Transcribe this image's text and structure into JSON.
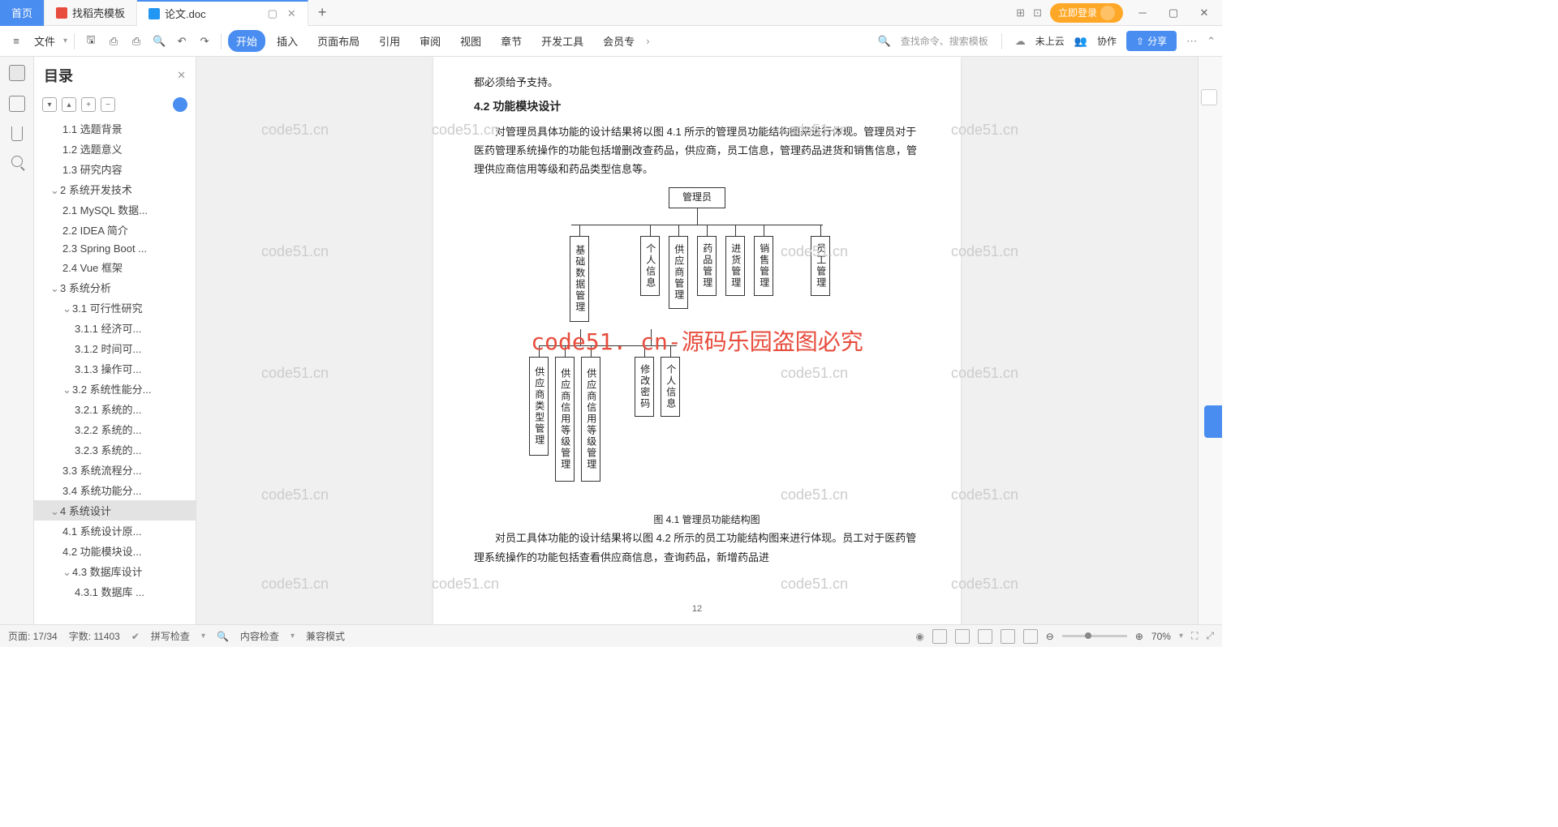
{
  "tabs": {
    "home": "首页",
    "template": "找稻壳模板",
    "doc": "论文.doc"
  },
  "login_btn": "立即登录",
  "file_menu": "文件",
  "menu": {
    "start": "开始",
    "insert": "插入",
    "layout": "页面布局",
    "reference": "引用",
    "review": "审阅",
    "view": "视图",
    "section": "章节",
    "dev": "开发工具",
    "member": "会员专"
  },
  "search_placeholder": "查找命令、搜索模板",
  "cloud_status": "未上云",
  "collab": "协作",
  "share": "分享",
  "outline": {
    "title": "目录",
    "items": [
      {
        "lv": 2,
        "txt": "1.1 选题背景"
      },
      {
        "lv": 2,
        "txt": "1.2 选题意义"
      },
      {
        "lv": 2,
        "txt": "1.3 研究内容"
      },
      {
        "lv": 1,
        "txt": "2 系统开发技术",
        "caret": true
      },
      {
        "lv": 2,
        "txt": "2.1 MySQL 数据..."
      },
      {
        "lv": 2,
        "txt": "2.2 IDEA 简介"
      },
      {
        "lv": 2,
        "txt": "2.3 Spring Boot ..."
      },
      {
        "lv": 2,
        "txt": "2.4 Vue 框架"
      },
      {
        "lv": 1,
        "txt": "3 系统分析",
        "caret": true
      },
      {
        "lv": 2,
        "txt": "3.1 可行性研究",
        "caret": true
      },
      {
        "lv": 3,
        "txt": "3.1.1 经济可..."
      },
      {
        "lv": 3,
        "txt": "3.1.2 时间可..."
      },
      {
        "lv": 3,
        "txt": "3.1.3 操作可..."
      },
      {
        "lv": 2,
        "txt": "3.2 系统性能分...",
        "caret": true
      },
      {
        "lv": 3,
        "txt": "3.2.1 系统的..."
      },
      {
        "lv": 3,
        "txt": "3.2.2 系统的..."
      },
      {
        "lv": 3,
        "txt": "3.2.3 系统的..."
      },
      {
        "lv": 2,
        "txt": "3.3 系统流程分..."
      },
      {
        "lv": 2,
        "txt": "3.4 系统功能分..."
      },
      {
        "lv": 1,
        "txt": "4 系统设计",
        "caret": true,
        "selected": true
      },
      {
        "lv": 2,
        "txt": "4.1 系统设计原..."
      },
      {
        "lv": 2,
        "txt": "4.2 功能模块设..."
      },
      {
        "lv": 2,
        "txt": "4.3 数据库设计",
        "caret": true
      },
      {
        "lv": 3,
        "txt": "4.3.1 数据库 ..."
      }
    ]
  },
  "doc": {
    "line0": "都必须给予支持。",
    "heading": "4.2 功能模块设计",
    "p1": "对管理员具体功能的设计结果将以图 4.1 所示的管理员功能结构图来进行体现。管理员对于医药管理系统操作的功能包括增删改查药品，供应商，员工信息，管理药品进货和销售信息，管理供应商信用等级和药品类型信息等。",
    "caption": "图 4.1 管理员功能结构图",
    "p2": "对员工具体功能的设计结果将以图 4.2 所示的员工功能结构图来进行体现。员工对于医药管理系统操作的功能包括查看供应商信息，查询药品，新增药品进",
    "page_num": "12",
    "diagram": {
      "root": "管理员",
      "row1": [
        "基础数据管理",
        "个人信息",
        "供应商管理",
        "药品管理",
        "进货管理",
        "销售管理",
        "员工管理"
      ],
      "row2": [
        "供应商类型管理",
        "供应商信用等级管理",
        "供应商信用等级管理",
        "修改密码",
        "个人信息"
      ]
    }
  },
  "watermark": "code51. cn-源码乐园盗图必究",
  "wm_bg": "code51.cn",
  "status": {
    "page": "页面: 17/34",
    "words": "字数: 11403",
    "spell": "拼写检查",
    "content": "内容检查",
    "compat": "兼容模式",
    "zoom": "70%"
  }
}
